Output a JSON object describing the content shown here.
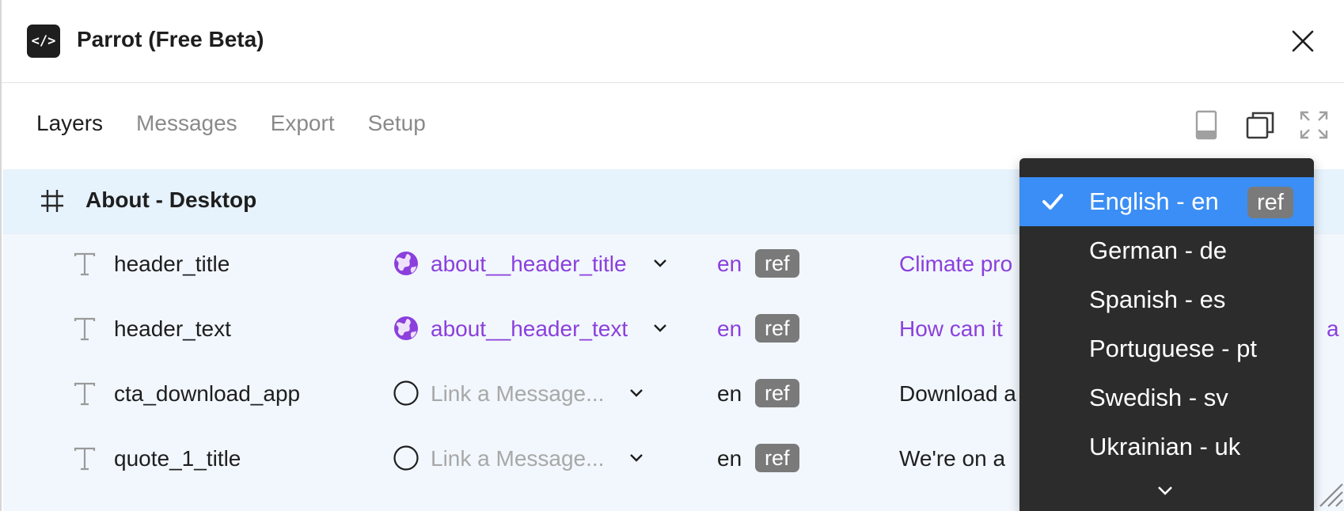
{
  "app": {
    "logo_text": "</>",
    "title": "Parrot (Free Beta)"
  },
  "tabs": [
    {
      "label": "Layers",
      "active": true
    },
    {
      "label": "Messages",
      "active": false
    },
    {
      "label": "Export",
      "active": false
    },
    {
      "label": "Setup",
      "active": false
    }
  ],
  "view_icons": [
    "mobile-view-icon",
    "window-view-icon",
    "fullscreen-icon"
  ],
  "frame": {
    "name": "About - Desktop",
    "icon": "frame-hash-icon"
  },
  "rows": [
    {
      "layer": "header_title",
      "message": "about__header_title",
      "linked": true,
      "lang": "en",
      "badge": "ref",
      "preview": "Climate pro",
      "preview_tail": ""
    },
    {
      "layer": "header_text",
      "message": "about__header_text",
      "linked": true,
      "lang": "en",
      "badge": "ref",
      "preview": "How can it",
      "preview_tail": "a"
    },
    {
      "layer": "cta_download_app",
      "message": "Link a Message...",
      "linked": false,
      "lang": "en",
      "badge": "ref",
      "preview": "Download a",
      "preview_tail": ""
    },
    {
      "layer": "quote_1_title",
      "message": "Link a Message...",
      "linked": false,
      "lang": "en",
      "badge": "ref",
      "preview": "We're on a",
      "preview_tail": ""
    }
  ],
  "language_dropdown": {
    "items": [
      {
        "label": "English - en",
        "badge": "ref",
        "selected": true
      },
      {
        "label": "German - de",
        "badge": "",
        "selected": false
      },
      {
        "label": "Spanish - es",
        "badge": "",
        "selected": false
      },
      {
        "label": "Portuguese - pt",
        "badge": "",
        "selected": false
      },
      {
        "label": "Swedish - sv",
        "badge": "",
        "selected": false
      },
      {
        "label": "Ukrainian - uk",
        "badge": "",
        "selected": false
      }
    ]
  },
  "colors": {
    "accent_purple": "#8b3fdc",
    "selected_blue": "#3b8ef5",
    "dropdown_bg": "#2c2c2c",
    "frame_row_bg": "#e6f2fc",
    "badge_gray": "#7a7a7a"
  }
}
